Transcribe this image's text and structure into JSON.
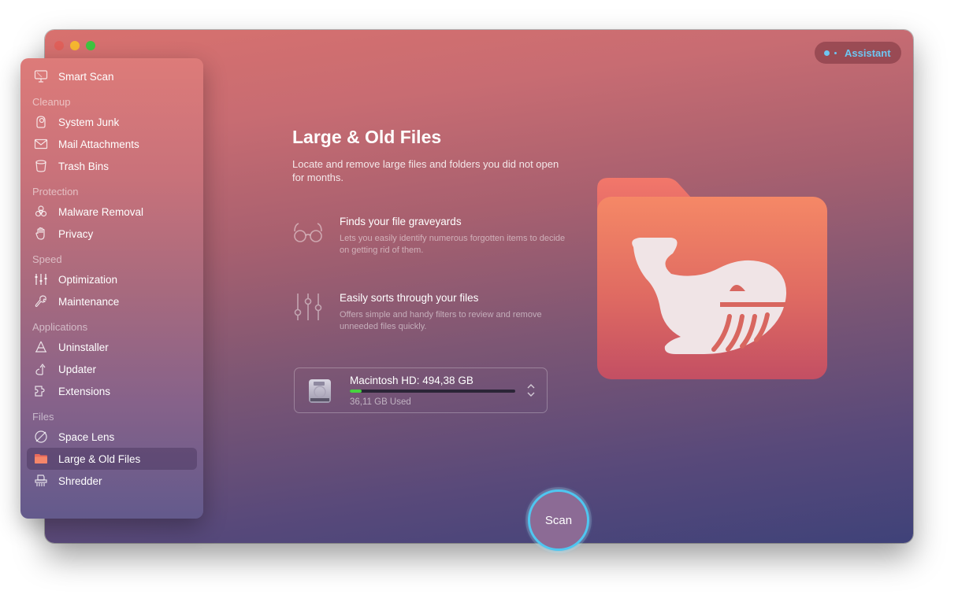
{
  "window": {
    "traffic_lights": [
      "close",
      "minimize",
      "maximize"
    ],
    "assistant_label": "Assistant",
    "accent_color": "#6ec6f2"
  },
  "sidebar": {
    "top_item": {
      "label": "Smart Scan",
      "icon": "monitor-icon"
    },
    "sections": [
      {
        "title": "Cleanup",
        "items": [
          {
            "label": "System Junk",
            "icon": "junk-icon"
          },
          {
            "label": "Mail Attachments",
            "icon": "mail-icon"
          },
          {
            "label": "Trash Bins",
            "icon": "trash-icon"
          }
        ]
      },
      {
        "title": "Protection",
        "items": [
          {
            "label": "Malware Removal",
            "icon": "biohazard-icon"
          },
          {
            "label": "Privacy",
            "icon": "hand-icon"
          }
        ]
      },
      {
        "title": "Speed",
        "items": [
          {
            "label": "Optimization",
            "icon": "sliders-icon"
          },
          {
            "label": "Maintenance",
            "icon": "wrench-icon"
          }
        ]
      },
      {
        "title": "Applications",
        "items": [
          {
            "label": "Uninstaller",
            "icon": "uninstaller-icon"
          },
          {
            "label": "Updater",
            "icon": "updater-icon"
          },
          {
            "label": "Extensions",
            "icon": "extensions-icon"
          }
        ]
      },
      {
        "title": "Files",
        "items": [
          {
            "label": "Space Lens",
            "icon": "space-lens-icon"
          },
          {
            "label": "Large & Old Files",
            "icon": "folder-icon",
            "active": true
          },
          {
            "label": "Shredder",
            "icon": "shredder-icon"
          }
        ]
      }
    ]
  },
  "main": {
    "title": "Large & Old Files",
    "description": "Locate and remove large files and folders you did not open for months.",
    "features": [
      {
        "icon": "glasses-icon",
        "title": "Finds your file graveyards",
        "description": "Lets you easily identify numerous forgotten items to decide on getting rid of them."
      },
      {
        "icon": "filters-icon",
        "title": "Easily sorts through your files",
        "description": "Offers simple and handy filters to review and remove unneeded files quickly."
      }
    ],
    "disk": {
      "name": "Macintosh HD: 494,38 GB",
      "used_label": "36,11 GB Used",
      "used_fraction": 0.073,
      "bar_color": "#47d33f"
    },
    "scan_button": "Scan"
  }
}
